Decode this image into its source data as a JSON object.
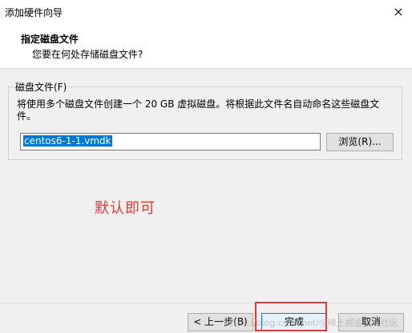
{
  "window": {
    "title": "添加硬件向导",
    "close_icon": "×"
  },
  "header": {
    "title": "指定磁盘文件",
    "subtitle": "您要在何处存储磁盘文件?"
  },
  "disk_file": {
    "group_label": "磁盘文件(F)",
    "description": "将使用多个磁盘文件创建一个 20 GB 虚拟磁盘。将根据此文件名自动命名这些磁盘文件。",
    "value": "centos6-1-1.vmdk",
    "browse_label": "浏览(R)..."
  },
  "annotation": {
    "text": "默认即可",
    "color": "#e53935"
  },
  "buttons": {
    "back": "< 上一步(B)",
    "finish": "完成",
    "cancel": "取消"
  },
  "watermark": "https://blog.csdn.net/@稀土掘金技术社区"
}
